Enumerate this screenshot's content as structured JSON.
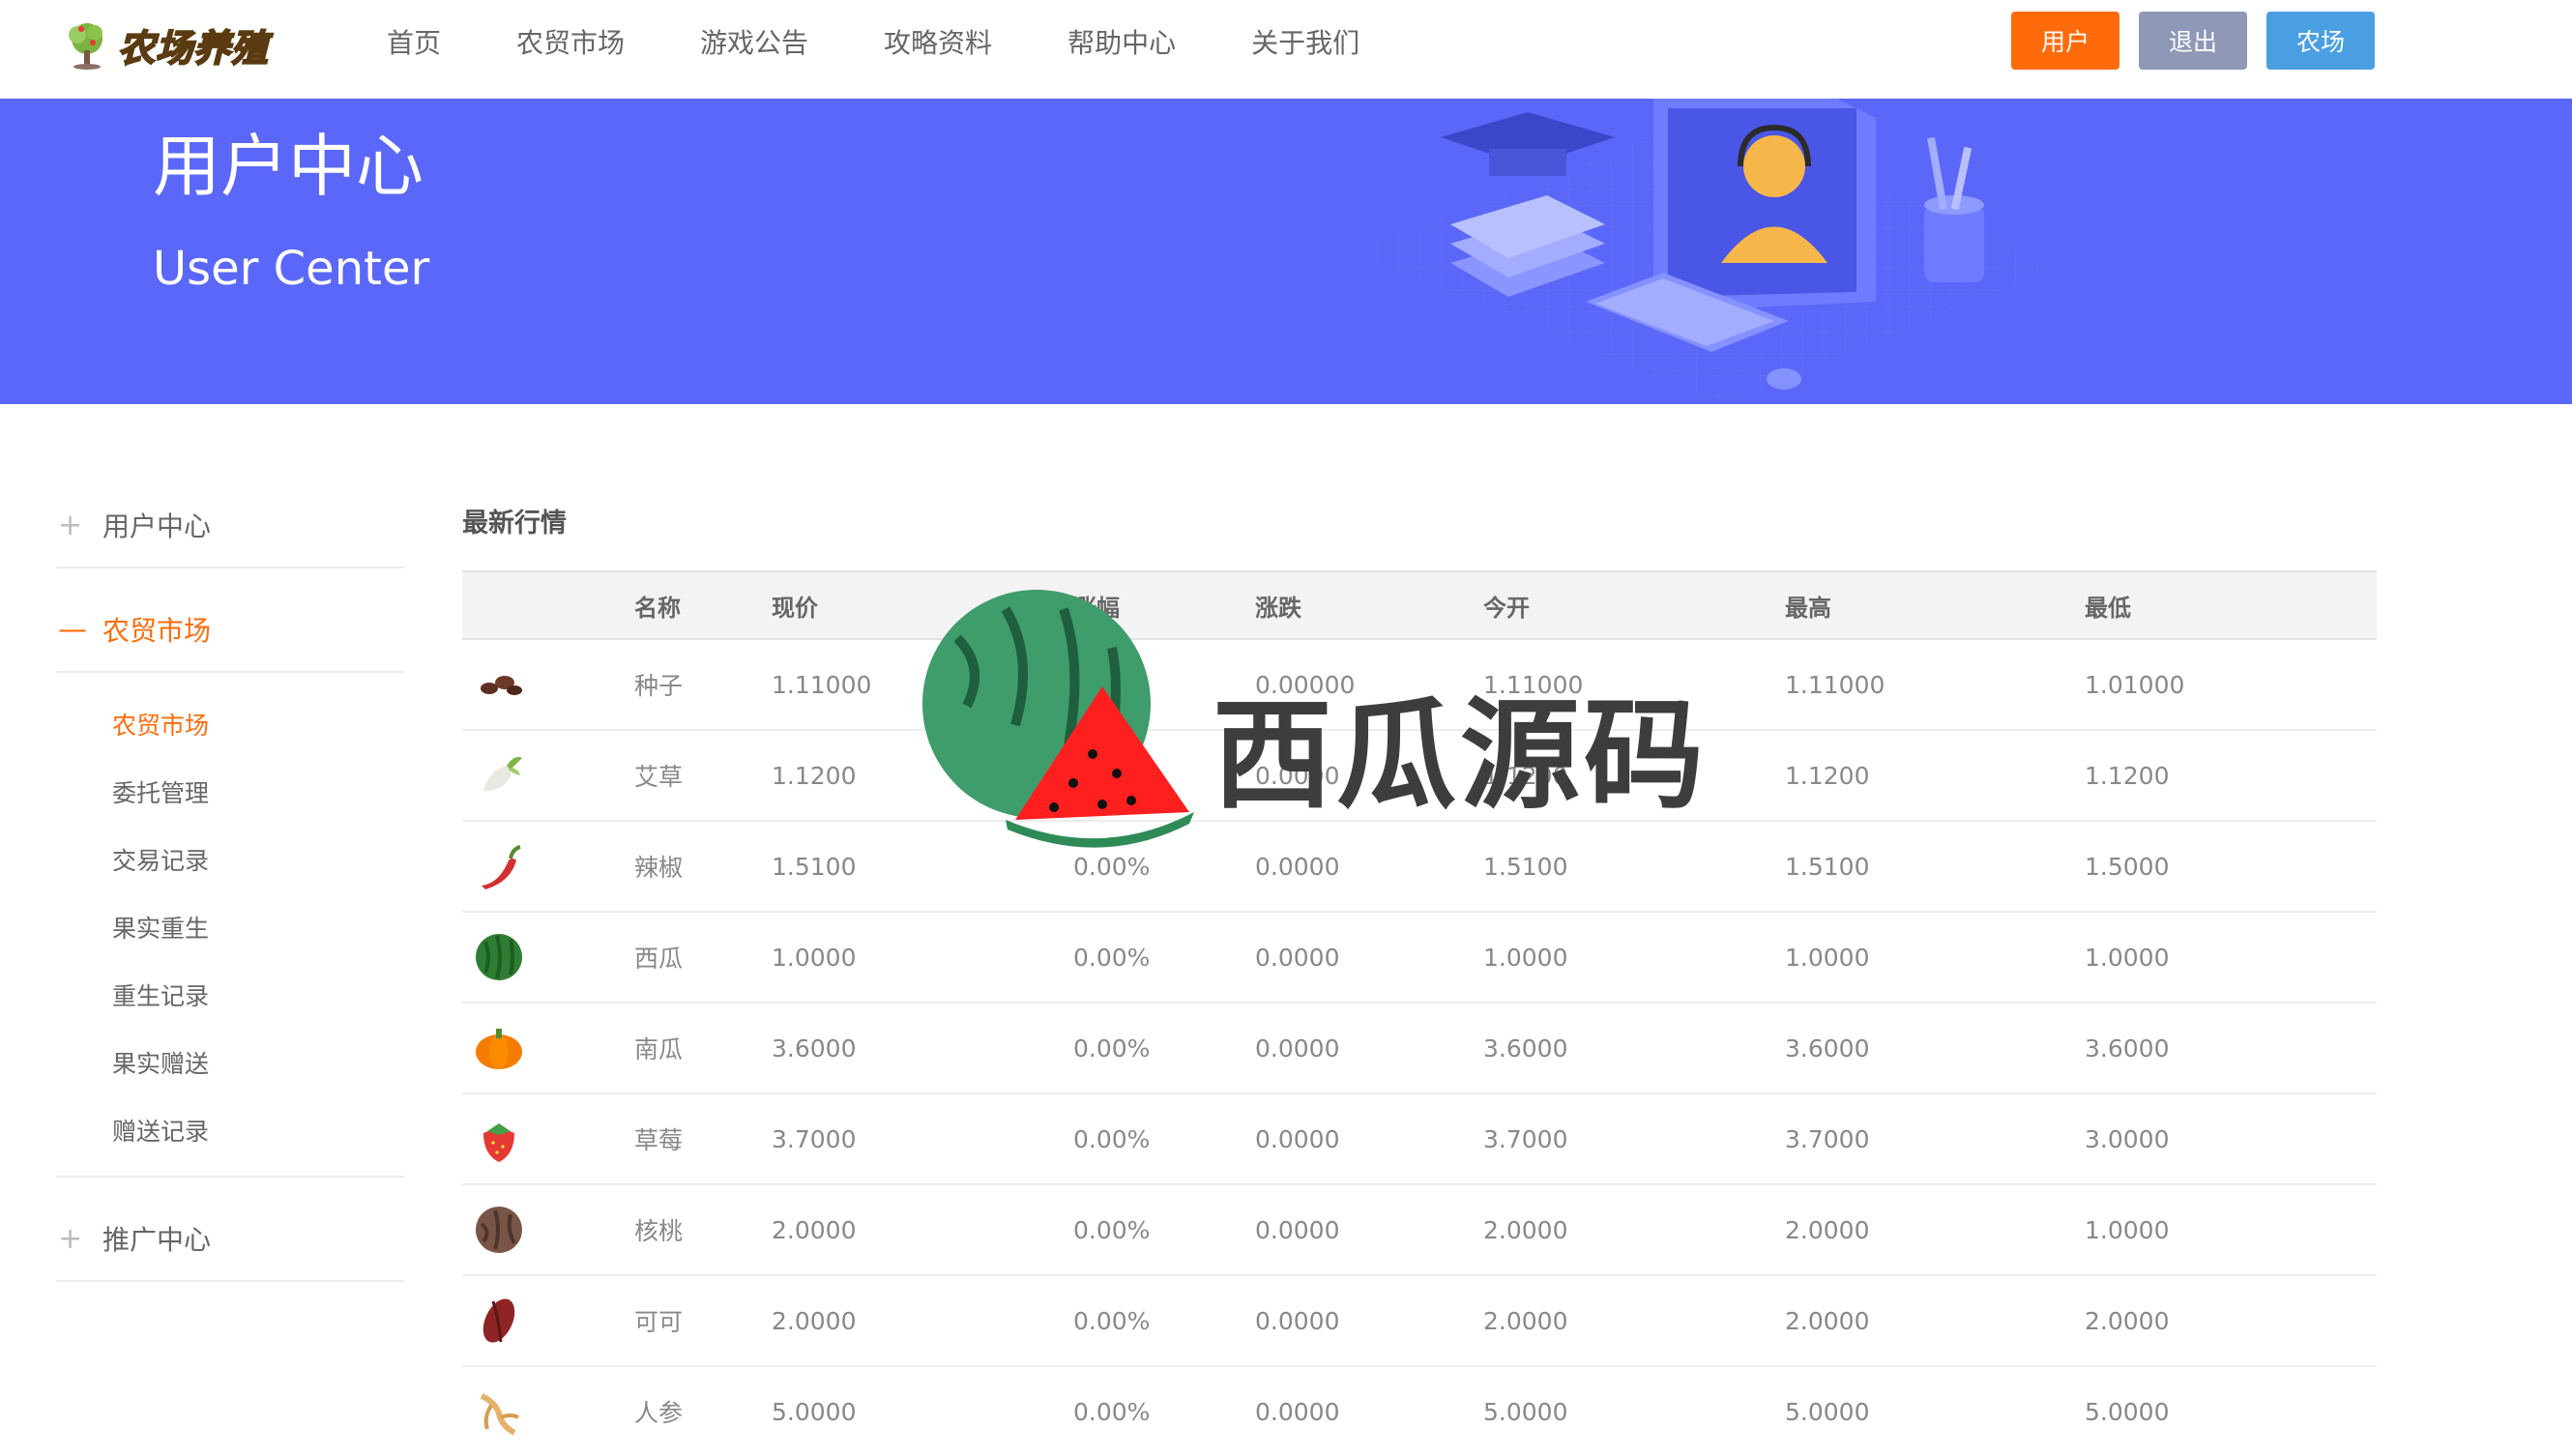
{
  "header": {
    "logo_text": "农场养殖",
    "nav": [
      "首页",
      "农贸市场",
      "游戏公告",
      "攻略资料",
      "帮助中心",
      "关于我们"
    ],
    "buttons": {
      "user": "用户",
      "logout": "退出",
      "farm": "农场"
    }
  },
  "banner": {
    "title": "用户中心",
    "subtitle": "User Center"
  },
  "sidebar": {
    "groups": [
      {
        "label": "用户中心",
        "mark": "+"
      },
      {
        "label": "农贸市场",
        "mark": "—"
      },
      {
        "label": "推广中心",
        "mark": "+"
      }
    ],
    "sub_items": [
      "农贸市场",
      "委托管理",
      "交易记录",
      "果实重生",
      "重生记录",
      "果实赠送",
      "赠送记录"
    ]
  },
  "market": {
    "title": "最新行情",
    "columns": [
      "",
      "名称",
      "现价",
      "涨幅",
      "涨跌",
      "今开",
      "最高",
      "最低"
    ],
    "rows": [
      {
        "icon": "seed-icon",
        "name": "种子",
        "price": "1.11000",
        "pct": "0.00%",
        "chg": "0.00000",
        "open": "1.11000",
        "high": "1.11000",
        "low": "1.01000"
      },
      {
        "icon": "radish-icon",
        "name": "艾草",
        "price": "1.1200",
        "pct": "0.00%",
        "chg": "0.0000",
        "open": "1.1200",
        "high": "1.1200",
        "low": "1.1200"
      },
      {
        "icon": "chili-icon",
        "name": "辣椒",
        "price": "1.5100",
        "pct": "0.00%",
        "chg": "0.0000",
        "open": "1.5100",
        "high": "1.5100",
        "low": "1.5000"
      },
      {
        "icon": "watermelon-icon",
        "name": "西瓜",
        "price": "1.0000",
        "pct": "0.00%",
        "chg": "0.0000",
        "open": "1.0000",
        "high": "1.0000",
        "low": "1.0000"
      },
      {
        "icon": "pumpkin-icon",
        "name": "南瓜",
        "price": "3.6000",
        "pct": "0.00%",
        "chg": "0.0000",
        "open": "3.6000",
        "high": "3.6000",
        "low": "3.6000"
      },
      {
        "icon": "strawberry-icon",
        "name": "草莓",
        "price": "3.7000",
        "pct": "0.00%",
        "chg": "0.0000",
        "open": "3.7000",
        "high": "3.7000",
        "low": "3.0000"
      },
      {
        "icon": "walnut-icon",
        "name": "核桃",
        "price": "2.0000",
        "pct": "0.00%",
        "chg": "0.0000",
        "open": "2.0000",
        "high": "2.0000",
        "low": "1.0000"
      },
      {
        "icon": "cacao-icon",
        "name": "可可",
        "price": "2.0000",
        "pct": "0.00%",
        "chg": "0.0000",
        "open": "2.0000",
        "high": "2.0000",
        "low": "2.0000"
      },
      {
        "icon": "ginseng-icon",
        "name": "人参",
        "price": "5.0000",
        "pct": "0.00%",
        "chg": "0.0000",
        "open": "5.0000",
        "high": "5.0000",
        "low": "5.0000"
      }
    ]
  },
  "watermark": {
    "text": "西瓜源码"
  },
  "colors": {
    "accent": "#ff6b0b",
    "banner": "#5a67f8",
    "logout": "#8e97b6",
    "farm": "#4a9fe3"
  }
}
